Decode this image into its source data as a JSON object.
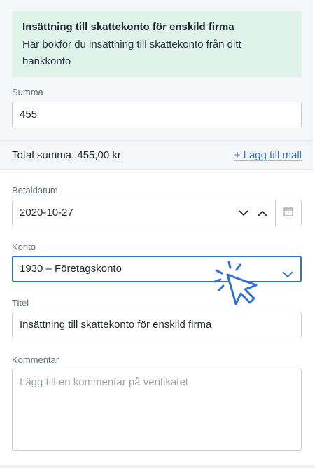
{
  "info": {
    "title": "Insättning till skattekonto för enskild firma",
    "text": "Här bokför du insättning till skattekonto från ditt bankkonto"
  },
  "summa": {
    "label": "Summa",
    "value": "455"
  },
  "total": {
    "text": "Total summa: 455,00 kr",
    "add_template": "+ Lägg till mall"
  },
  "betaldatum": {
    "label": "Betaldatum",
    "value": "2020-10-27"
  },
  "konto": {
    "label": "Konto",
    "value": "1930 – Företagskonto"
  },
  "titel": {
    "label": "Titel",
    "value": "Insättning till skattekonto för enskild firma"
  },
  "kommentar": {
    "label": "Kommentar",
    "placeholder": "Lägg till en kommentar på verifikatet"
  },
  "colors": {
    "accent": "#2e6fd6",
    "info_bg": "#dff3eb",
    "section_bg": "#f4f6f8"
  },
  "icons": [
    "chevron-down-icon",
    "chevron-up-icon",
    "calendar-icon",
    "pointer-cursor-icon"
  ]
}
